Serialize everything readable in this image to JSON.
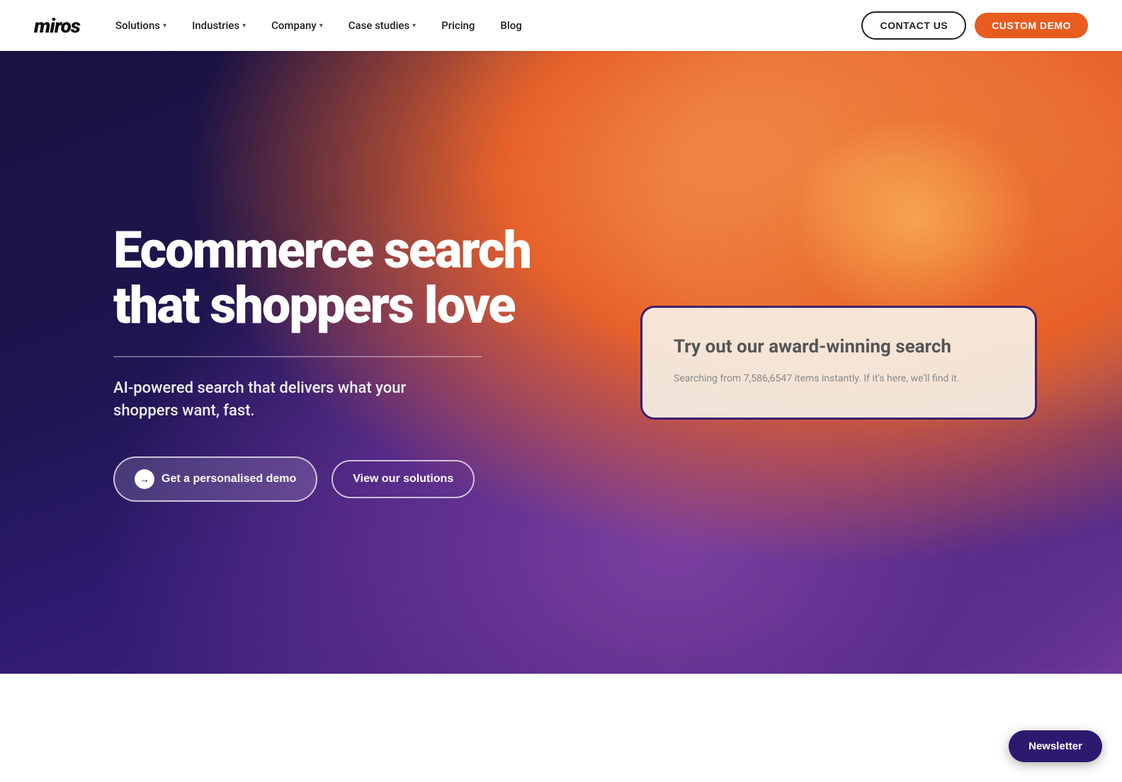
{
  "nav": {
    "logo": "miros",
    "links": [
      {
        "id": "solutions",
        "label": "Solutions",
        "hasDropdown": true
      },
      {
        "id": "industries",
        "label": "Industries",
        "hasDropdown": true
      },
      {
        "id": "company",
        "label": "Company",
        "hasDropdown": true
      },
      {
        "id": "case-studies",
        "label": "Case studies",
        "hasDropdown": true
      },
      {
        "id": "pricing",
        "label": "Pricing",
        "hasDropdown": false
      },
      {
        "id": "blog",
        "label": "Blog",
        "hasDropdown": false
      }
    ],
    "contact_label": "CONTACT US",
    "demo_label": "CUSTOM DEMO"
  },
  "hero": {
    "title": "Ecommerce search that shoppers love",
    "subtitle": "AI-powered search that delivers what your shoppers want, fast.",
    "btn_demo_label": "Get a personalised demo",
    "btn_solutions_label": "View our solutions",
    "search_card": {
      "title": "Try out our award-winning search",
      "subtitle": "Searching from 7,586,6547 items instantly. If it's here, we'll find it."
    }
  },
  "newsletter": {
    "label": "Newsletter"
  },
  "colors": {
    "accent_orange": "#E85C20",
    "accent_purple": "#2d1a6e",
    "card_border": "#3d1f6e"
  }
}
